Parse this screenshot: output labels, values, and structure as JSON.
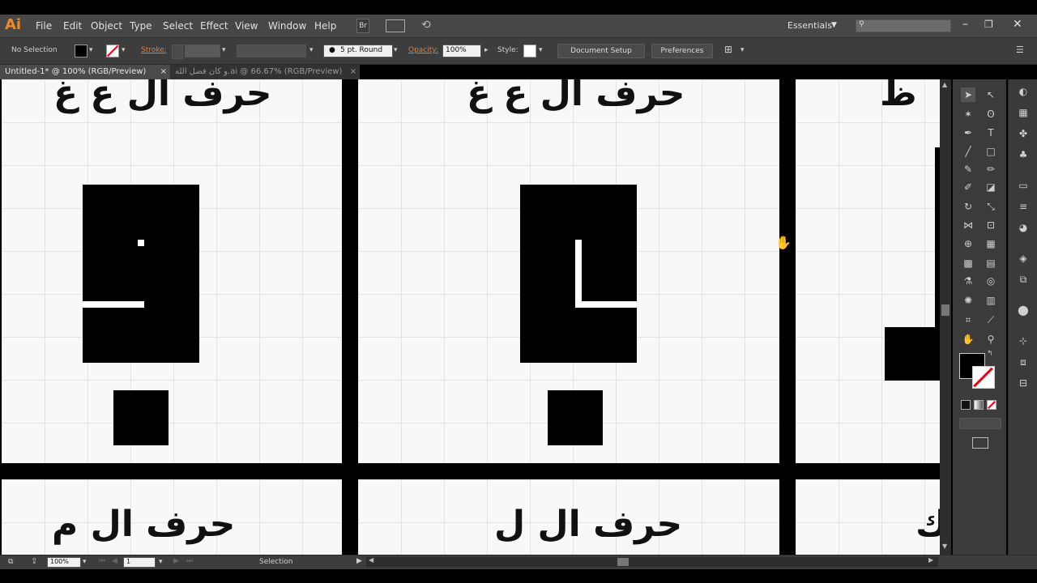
{
  "app": {
    "logo": "Ai",
    "menu": [
      "File",
      "Edit",
      "Object",
      "Type",
      "Select",
      "Effect",
      "View",
      "Window",
      "Help"
    ],
    "br_label": "Br",
    "workspace": "Essentials",
    "search_placeholder": ""
  },
  "control": {
    "selection_label": "No Selection",
    "stroke_label": "Stroke:",
    "brush_label": "5 pt. Round",
    "opacity_label": "Opacity:",
    "opacity_value": "100%",
    "style_label": "Style:",
    "document_setup": "Document Setup",
    "preferences": "Preferences"
  },
  "tabs": [
    {
      "label": "Untitled-1* @ 100% (RGB/Preview)",
      "close": "×"
    },
    {
      "label": "و كان فضل الله.ai @ 66.67% (RGB/Preview)",
      "close": "×"
    }
  ],
  "canvas": {
    "p1_title": "حرف ال ع غ",
    "p2_title": "حرف ال ع غ",
    "p3_title": "ظ",
    "p4_title": "حرف ال م",
    "p5_title": "حرف ال ل",
    "p6_title": "ك"
  },
  "status": {
    "zoom": "100%",
    "page": "1",
    "tool": "Selection"
  },
  "colors": {
    "accent": "#f08a24",
    "menubar": "#474747",
    "panel_bg": "#3d3d3d"
  }
}
